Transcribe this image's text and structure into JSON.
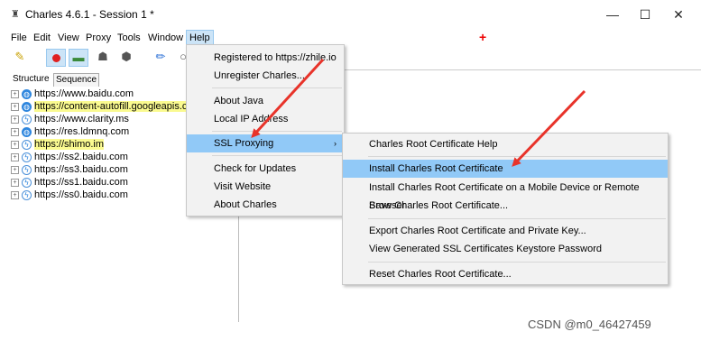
{
  "window": {
    "title": "Charles 4.6.1 - Session 1 *",
    "minimize": "—",
    "maximize": "☐",
    "close": "✕"
  },
  "menubar": {
    "items": [
      "File",
      "Edit",
      "View",
      "Proxy",
      "Tools",
      "Window",
      "Help"
    ],
    "red_marker": "+"
  },
  "toolbar": {
    "icons": [
      "broom-icon",
      "record-icon",
      "throttle-icon",
      "turtle-icon",
      "stop-icon",
      "pen-icon",
      "search-icon"
    ]
  },
  "left_panel": {
    "tabs": [
      "Structure",
      "Sequence"
    ],
    "hosts": [
      {
        "url": "https://www.baidu.com",
        "icon": "ssl-globe-icon",
        "highlight": false
      },
      {
        "url": "https://content-autofill.googleapis.co",
        "icon": "ssl-globe-icon",
        "highlight": true
      },
      {
        "url": "https://www.clarity.ms",
        "icon": "lightning-icon",
        "highlight": false
      },
      {
        "url": "https://res.ldmnq.com",
        "icon": "ssl-globe-icon",
        "highlight": false
      },
      {
        "url": "https://shimo.im",
        "icon": "lightning-icon",
        "highlight": true
      },
      {
        "url": "https://ss2.baidu.com",
        "icon": "lightning-icon",
        "highlight": false
      },
      {
        "url": "https://ss3.baidu.com",
        "icon": "lightning-icon",
        "highlight": false
      },
      {
        "url": "https://ss1.baidu.com",
        "icon": "lightning-icon",
        "highlight": false
      },
      {
        "url": "https://ss0.baidu.com",
        "icon": "lightning-icon",
        "highlight": false
      }
    ]
  },
  "help_menu": {
    "registered": "Registered to https://zhile.io",
    "unregister": "Unregister Charles...",
    "about_java": "About Java",
    "local_ip": "Local IP Address",
    "ssl_proxying": "SSL Proxying",
    "submenu_arrow": "›",
    "check_updates": "Check for Updates",
    "visit_website": "Visit Website",
    "about_charles": "About Charles"
  },
  "ssl_submenu": {
    "root_help": "Charles Root Certificate Help",
    "install_root": "Install Charles Root Certificate",
    "install_mobile": "Install Charles Root Certificate on a Mobile Device or Remote Browser",
    "save_root": "Save Charles Root Certificate...",
    "export_root": "Export Charles Root Certificate and Private Key...",
    "view_keystore": "View Generated SSL Certificates Keystore Password",
    "reset_root": "Reset Charles Root Certificate..."
  },
  "watermark": "CSDN @m0_46427459",
  "colors": {
    "menu_highlight": "#91c9f7",
    "annotation_arrow": "#e8332a",
    "host_highlight": "#fafa90"
  }
}
